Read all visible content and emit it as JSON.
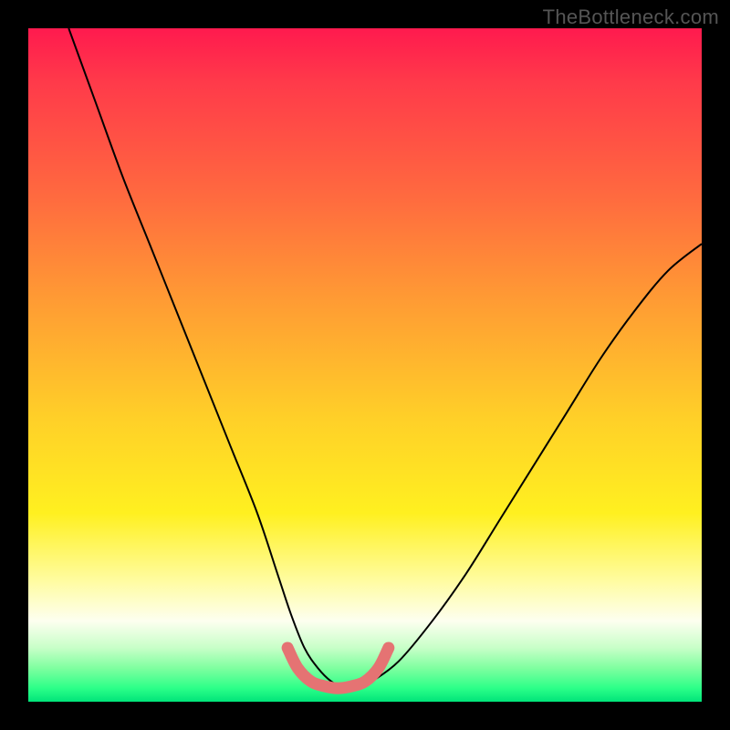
{
  "watermark": "TheBottleneck.com",
  "chart_data": {
    "type": "line",
    "title": "",
    "xlabel": "",
    "ylabel": "",
    "xlim": [
      0,
      100
    ],
    "ylim": [
      0,
      100
    ],
    "grid": false,
    "legend": false,
    "background_gradient": {
      "direction": "vertical",
      "stops": [
        {
          "pos": 0.0,
          "color": "#ff1a4e"
        },
        {
          "pos": 0.08,
          "color": "#ff3a4a"
        },
        {
          "pos": 0.25,
          "color": "#ff6a3f"
        },
        {
          "pos": 0.4,
          "color": "#ff9a34"
        },
        {
          "pos": 0.58,
          "color": "#ffd028"
        },
        {
          "pos": 0.72,
          "color": "#fff020"
        },
        {
          "pos": 0.82,
          "color": "#fffca0"
        },
        {
          "pos": 0.88,
          "color": "#fdfff0"
        },
        {
          "pos": 0.92,
          "color": "#c8ffc8"
        },
        {
          "pos": 0.95,
          "color": "#7fffa0"
        },
        {
          "pos": 0.98,
          "color": "#2cff88"
        },
        {
          "pos": 1.0,
          "color": "#00e47a"
        }
      ]
    },
    "series": [
      {
        "name": "bottleneck-curve",
        "stroke": "#000000",
        "stroke_width": 2,
        "x": [
          6,
          10,
          14,
          18,
          22,
          26,
          30,
          34,
          37,
          39,
          41,
          43,
          45,
          47,
          49,
          51,
          55,
          60,
          65,
          70,
          75,
          80,
          85,
          90,
          95,
          100
        ],
        "y": [
          100,
          89,
          78,
          68,
          58,
          48,
          38,
          28,
          19,
          13,
          8,
          5,
          3,
          2,
          2,
          3,
          6,
          12,
          19,
          27,
          35,
          43,
          51,
          58,
          64,
          68
        ]
      },
      {
        "name": "optimal-zone-highlight",
        "stroke": "#e57373",
        "stroke_width": 13,
        "linecap": "round",
        "x": [
          38.5,
          40,
          42,
          44,
          46,
          48,
          50,
          52,
          53.5
        ],
        "y": [
          8,
          5,
          3,
          2.3,
          2,
          2.3,
          3,
          5,
          8
        ]
      }
    ]
  }
}
